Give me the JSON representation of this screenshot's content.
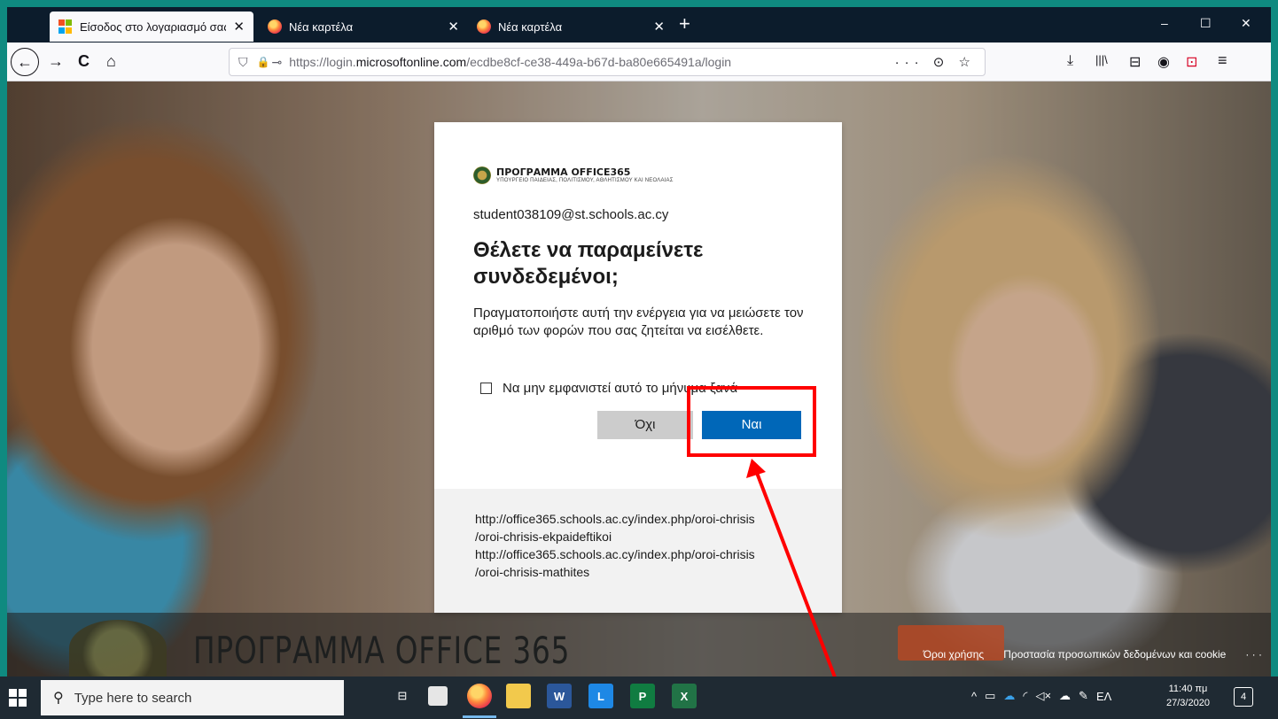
{
  "browser": {
    "tabs": [
      {
        "title": "Είσοδος στο λογαριασμό σας",
        "close": "✕"
      },
      {
        "title": "Νέα καρτέλα",
        "close": "✕"
      },
      {
        "title": "Νέα καρτέλα",
        "close": "✕"
      }
    ],
    "new_tab": "+",
    "window_controls": {
      "minimize": "–",
      "maximize": "☐",
      "close": "✕"
    },
    "url": {
      "prefix": "https://login.",
      "domain": "microsoftonline.com",
      "path": "/ecdbe8cf-ce38-449a-b67d-ba80e665491a/login"
    },
    "icons": {
      "back": "←",
      "forward": "→",
      "reload": "C",
      "home": "⌂",
      "shield": "⛉",
      "lock": "🔒",
      "key": "⊸",
      "more": "···",
      "pocket": "⊙",
      "bookmark": "☆",
      "download": "⤓",
      "library": "|||\\",
      "sidebar": "⊟",
      "account": "◉",
      "ext": "⊡",
      "menu": "≡"
    }
  },
  "page": {
    "banner_title": "ΠΡΟΓΡΑΜΜΑ OFFICE 365",
    "footer_links": [
      "Όροι χρήσης",
      "Προστασία προσωπικών δεδομένων και cookie",
      "· · ·"
    ]
  },
  "dialog": {
    "org_name": "ΠΡΟΓΡΑΜΜΑ OFFICE365",
    "org_subtitle": "ΥΠΟΥΡΓΕΙΟ ΠΑΙΔΕΙΑΣ, ΠΟΛΙΤΙΣΜΟΥ, ΑΘΛΗΤΙΣΜΟΥ ΚΑΙ ΝΕΟΛΑΙΑΣ",
    "account": "student038109@st.schools.ac.cy",
    "title": "Θέλετε να παραμείνετε συνδεδεμένοι;",
    "description": "Πραγματοποιήστε αυτή την ενέργεια για να μειώσετε τον αριθμό των φορών που σας ζητείται να εισέλθετε.",
    "checkbox_label": "Να μην εμφανιστεί αυτό το μήνυμα ξανά",
    "no_label": "Όχι",
    "yes_label": "Ναι",
    "terms_line1": "http://office365.schools.ac.cy/index.php/oroi-chrisis",
    "terms_line2": "/oroi-chrisis-ekpaideftikoi",
    "terms_line3": "http://office365.schools.ac.cy/index.php/oroi-chrisis",
    "terms_line4": "/oroi-chrisis-mathites"
  },
  "taskbar": {
    "search_placeholder": "Type here to search",
    "apps": [
      "Task View",
      "Store",
      "Firefox",
      "File Explorer",
      "W",
      "L",
      "P",
      "X"
    ],
    "tray": {
      "chevron": "^",
      "language": "ΕΛ"
    },
    "time": "11:40 πμ",
    "date": "27/3/2020",
    "notifications": "4"
  },
  "colors": {
    "accent_button": "#0067b8",
    "annotation": "#ff0000",
    "taskbar": "#1f2a33"
  }
}
